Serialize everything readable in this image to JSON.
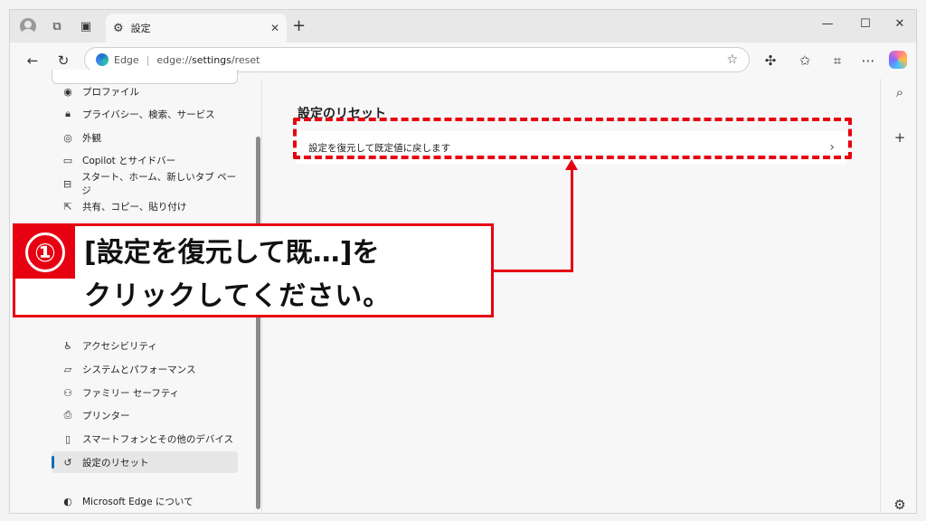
{
  "tab": {
    "title": "設定"
  },
  "address": {
    "site": "Edge",
    "url_prefix": "edge://",
    "url_bold": "settings",
    "url_suffix": "/reset"
  },
  "sidebar": {
    "items": [
      {
        "label": "プロファイル",
        "icon": "profile-icon"
      },
      {
        "label": "プライバシー、検索、サービス",
        "icon": "lock-icon"
      },
      {
        "label": "外観",
        "icon": "palette-icon"
      },
      {
        "label": "Copilot とサイドバー",
        "icon": "sidebar-icon"
      },
      {
        "label": "スタート、ホーム、新しいタブ ページ",
        "icon": "home-page-icon"
      },
      {
        "label": "共有、コピー、貼り付け",
        "icon": "share-icon"
      },
      {
        "label": "アクセシビリティ",
        "icon": "accessibility-icon"
      },
      {
        "label": "システムとパフォーマンス",
        "icon": "laptop-icon"
      },
      {
        "label": "ファミリー セーフティ",
        "icon": "family-icon"
      },
      {
        "label": "プリンター",
        "icon": "printer-icon"
      },
      {
        "label": "スマートフォンとその他のデバイス",
        "icon": "phone-icon"
      },
      {
        "label": "設定のリセット",
        "icon": "reset-icon"
      },
      {
        "label": "Microsoft Edge について",
        "icon": "edge-logo-icon"
      }
    ]
  },
  "main": {
    "section_title": "設定のリセット",
    "reset_option": "設定を復元して既定値に戻します"
  },
  "callout": {
    "number": "①",
    "line1": "[設定を復元して既…]を",
    "line2": "クリックしてください。"
  },
  "colors": {
    "accent_red": "#e60012",
    "active_blue": "#0f6cbd"
  }
}
